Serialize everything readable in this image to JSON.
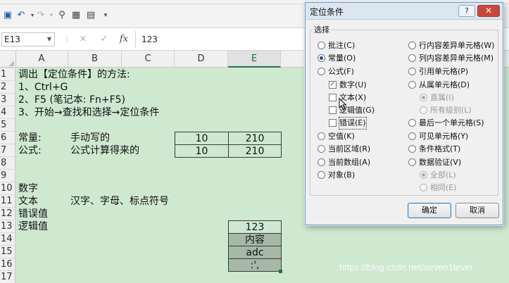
{
  "toolbar": {
    "icons": [
      "save-icon",
      "undo-icon",
      "redo-icon",
      "print-preview-icon",
      "image-icon",
      "form-icon"
    ]
  },
  "formula_bar": {
    "name_box": "E13",
    "cancel_symbol": "×",
    "enter_symbol": "✓",
    "fx_symbol": "fx",
    "value": "123"
  },
  "sheet": {
    "columns": [
      "A",
      "B",
      "C",
      "D",
      "E"
    ],
    "rows": [
      "1",
      "2",
      "3",
      "4",
      "5",
      "6",
      "7",
      "8",
      "9",
      "10",
      "11",
      "12",
      "13",
      "14",
      "15",
      "16",
      "17"
    ],
    "cells": {
      "a1": "调出【定位条件】的方法:",
      "a2": "1、Ctrl+G",
      "a3": "2、F5 (笔记本: Fn+F5)",
      "a4": "3、开始→查找和选择→定位条件",
      "a6": "常量:",
      "b6": "手动写的",
      "d6": "10",
      "e6": "210",
      "a7": "公式:",
      "b7": "公式计算得来的",
      "d7": "10",
      "e7": "210",
      "a10": "数字",
      "a11": "文本",
      "b11": "汉字、字母、标点符号",
      "a12": "错误值",
      "a13": "逻辑值",
      "e13": "123",
      "e14": "内容",
      "e15": "adc",
      "e16": ":',"
    }
  },
  "dialog": {
    "title": "定位条件",
    "help": "?",
    "close": "✕",
    "group_label": "选择",
    "left_options": [
      {
        "label": "批注(C)",
        "selected": false
      },
      {
        "label": "常量(O)",
        "selected": true
      },
      {
        "label": "公式(F)",
        "selected": false
      },
      {
        "label": "空值(K)",
        "selected": false
      },
      {
        "label": "当前区域(R)",
        "selected": false
      },
      {
        "label": "当前数组(A)",
        "selected": false
      },
      {
        "label": "对象(B)",
        "selected": false
      }
    ],
    "formula_checks": [
      {
        "label": "数字(U)",
        "checked": true
      },
      {
        "label": "文本(X)",
        "checked": false
      },
      {
        "label": "逻辑值(G)",
        "checked": false
      },
      {
        "label": "错误(E)",
        "checked": false
      }
    ],
    "right_options": [
      {
        "label": "行内容差异单元格(W)",
        "selected": false
      },
      {
        "label": "列内容差异单元格(M)",
        "selected": false
      },
      {
        "label": "引用单元格(P)",
        "selected": false
      },
      {
        "label": "从属单元格(D)",
        "selected": false
      },
      {
        "label": "最后一个单元格(S)",
        "selected": false
      },
      {
        "label": "可见单元格(Y)",
        "selected": false
      },
      {
        "label": "条件格式(T)",
        "selected": false
      },
      {
        "label": "数据验证(V)",
        "selected": false
      }
    ],
    "dependents_sub": [
      {
        "label": "直属(I)",
        "selected": true
      },
      {
        "label": "所有级别(L)",
        "selected": false
      }
    ],
    "validation_sub": [
      {
        "label": "全部(L)",
        "selected": true
      },
      {
        "label": "相同(E)",
        "selected": false
      }
    ],
    "ok": "确定",
    "cancel": "取消"
  },
  "watermark": "https://blog.csdn.net/seven1levin"
}
